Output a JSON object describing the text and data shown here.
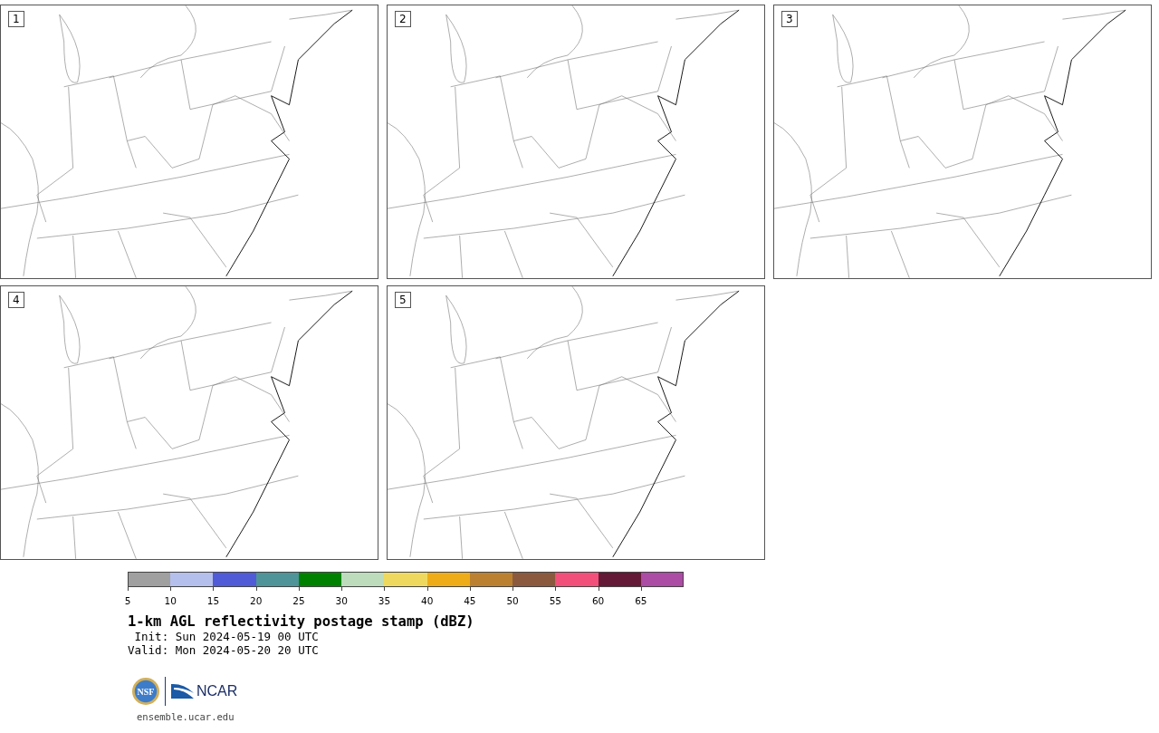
{
  "panels": [
    {
      "label": "1"
    },
    {
      "label": "2"
    },
    {
      "label": "3"
    },
    {
      "label": "4"
    },
    {
      "label": "5"
    }
  ],
  "colorbar": {
    "segments": [
      {
        "color": "#a0a0a0"
      },
      {
        "color": "#b4bfec"
      },
      {
        "color": "#505bd8"
      },
      {
        "color": "#4e9499"
      },
      {
        "color": "#008200"
      },
      {
        "color": "#bcdcbc"
      },
      {
        "color": "#eed95e"
      },
      {
        "color": "#eead18"
      },
      {
        "color": "#bb8131"
      },
      {
        "color": "#8b5a3e"
      },
      {
        "color": "#f2507a"
      },
      {
        "color": "#641936"
      },
      {
        "color": "#ac4ca4"
      }
    ],
    "ticks": [
      "5",
      "10",
      "15",
      "20",
      "25",
      "30",
      "35",
      "40",
      "45",
      "50",
      "55",
      "60",
      "65"
    ]
  },
  "title": "1-km AGL reflectivity postage stamp (dBZ)",
  "init": " Init: Sun 2024-05-19 00 UTC",
  "valid": "Valid: Mon 2024-05-20 20 UTC",
  "logo": {
    "seal_text": "NSF",
    "wordmark": "NCAR"
  },
  "website": "ensemble.ucar.edu"
}
